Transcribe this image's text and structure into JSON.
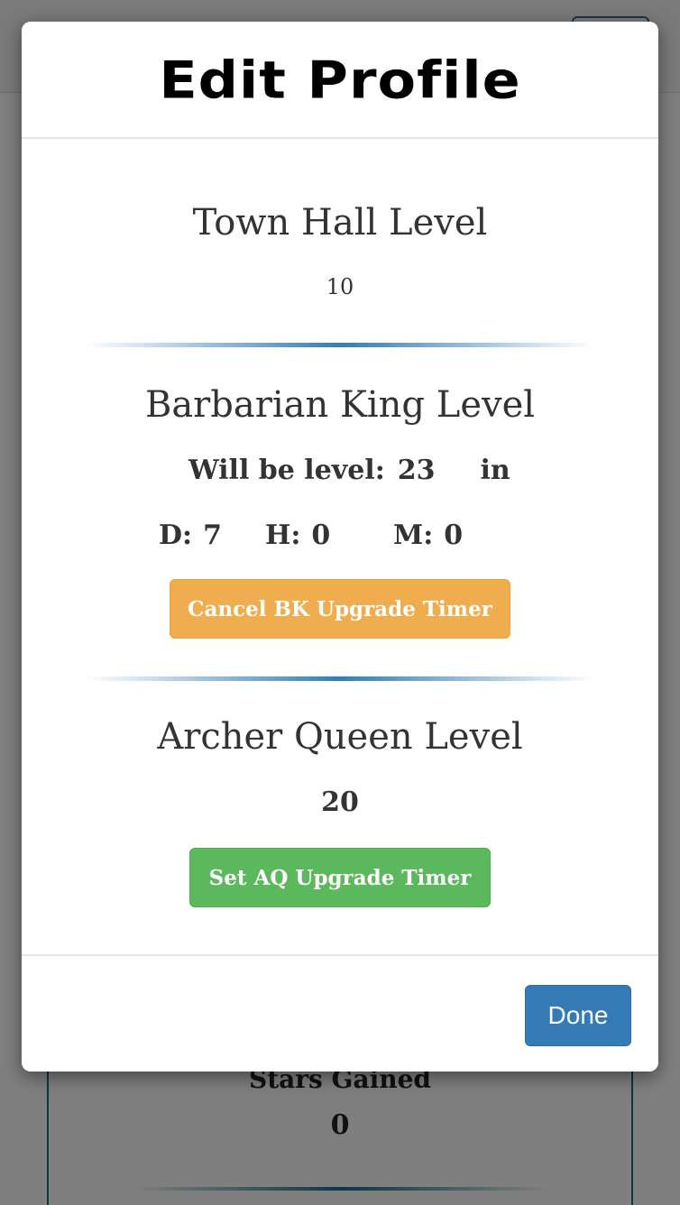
{
  "background": {
    "stat_label": "Stars Gained",
    "stat_value": "0"
  },
  "modal": {
    "title": "Edit Profile",
    "town_hall": {
      "title": "Town Hall Level",
      "value": "10"
    },
    "barbarian_king": {
      "title": "Barbarian King Level",
      "will_be_label": "Will be level:",
      "will_be_value": "23",
      "in_label": "in",
      "days_label": "D:",
      "days_value": "7",
      "hours_label": "H:",
      "hours_value": "0",
      "minutes_label": "M:",
      "minutes_value": "0",
      "cancel_button": "Cancel BK Upgrade Timer"
    },
    "archer_queen": {
      "title": "Archer Queen Level",
      "value": "20",
      "set_button": "Set AQ Upgrade Timer"
    },
    "done_button": "Done"
  },
  "colors": {
    "cancel_button": "#f0ad4e",
    "set_button": "#5cb85c",
    "done_button": "#337ab7",
    "divider": "#1b6fb4"
  }
}
